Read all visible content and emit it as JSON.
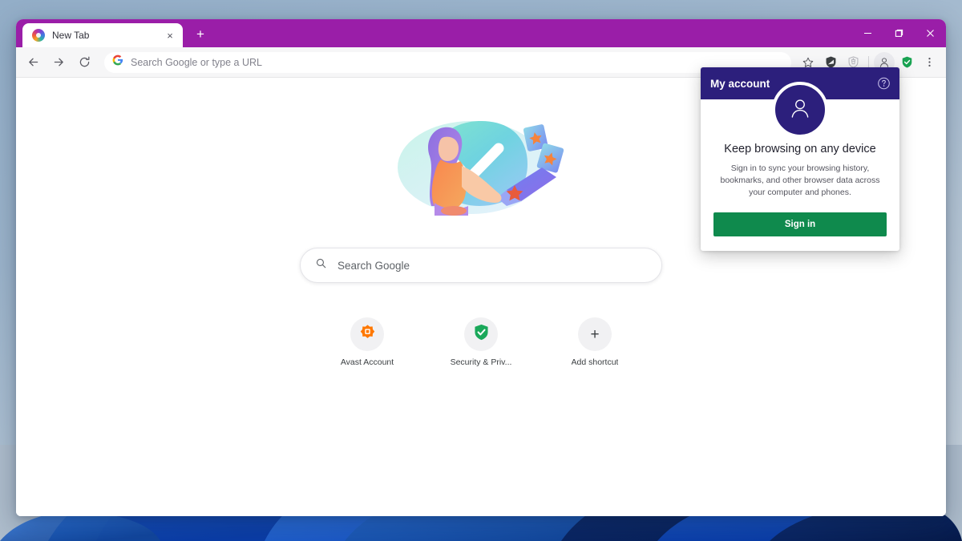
{
  "window": {
    "controls": {
      "minimize": "minimize-button",
      "maximize": "maximize-button",
      "close": "close-button"
    }
  },
  "tabs": [
    {
      "title": "New Tab",
      "favicon": "avast-browser-icon",
      "close": "×"
    }
  ],
  "new_tab_button": "+",
  "toolbar": {
    "back": "back-arrow-icon",
    "forward": "forward-arrow-icon",
    "reload": "reload-icon",
    "omnibox": {
      "placeholder": "Search Google or type a URL",
      "leading_icon": "google-g-icon"
    },
    "bookmark": "star-icon",
    "extension_1": "adblock-shield-icon",
    "extension_2": "privacy-extension-icon",
    "profile": "profile-avatar-icon",
    "security": "green-shield-check-icon",
    "menu": "three-dot-menu-icon"
  },
  "new_tab_page": {
    "illustration": "sync-devices-illustration",
    "search": {
      "placeholder": "Search Google",
      "icon": "search-icon"
    },
    "shortcuts": [
      {
        "label": "Avast Account",
        "icon": "avast-logo-icon"
      },
      {
        "label": "Security & Priv...",
        "icon": "green-check-shield-icon"
      },
      {
        "label": "Add shortcut",
        "icon": "plus-icon"
      }
    ]
  },
  "account_popup": {
    "title": "My account",
    "help_icon": "help-circle-icon",
    "avatar_icon": "person-icon",
    "heading": "Keep browsing on any device",
    "description": "Sign in to sync your browsing history, bookmarks, and other browser data across your computer and phones.",
    "sign_in_label": "Sign in"
  },
  "colors": {
    "title_bar": "#9a1ea8",
    "popup_header": "#2c1f7c",
    "sign_in_button": "#0f8a4d",
    "security_shield": "#19a352",
    "avast_orange": "#ff7800"
  }
}
